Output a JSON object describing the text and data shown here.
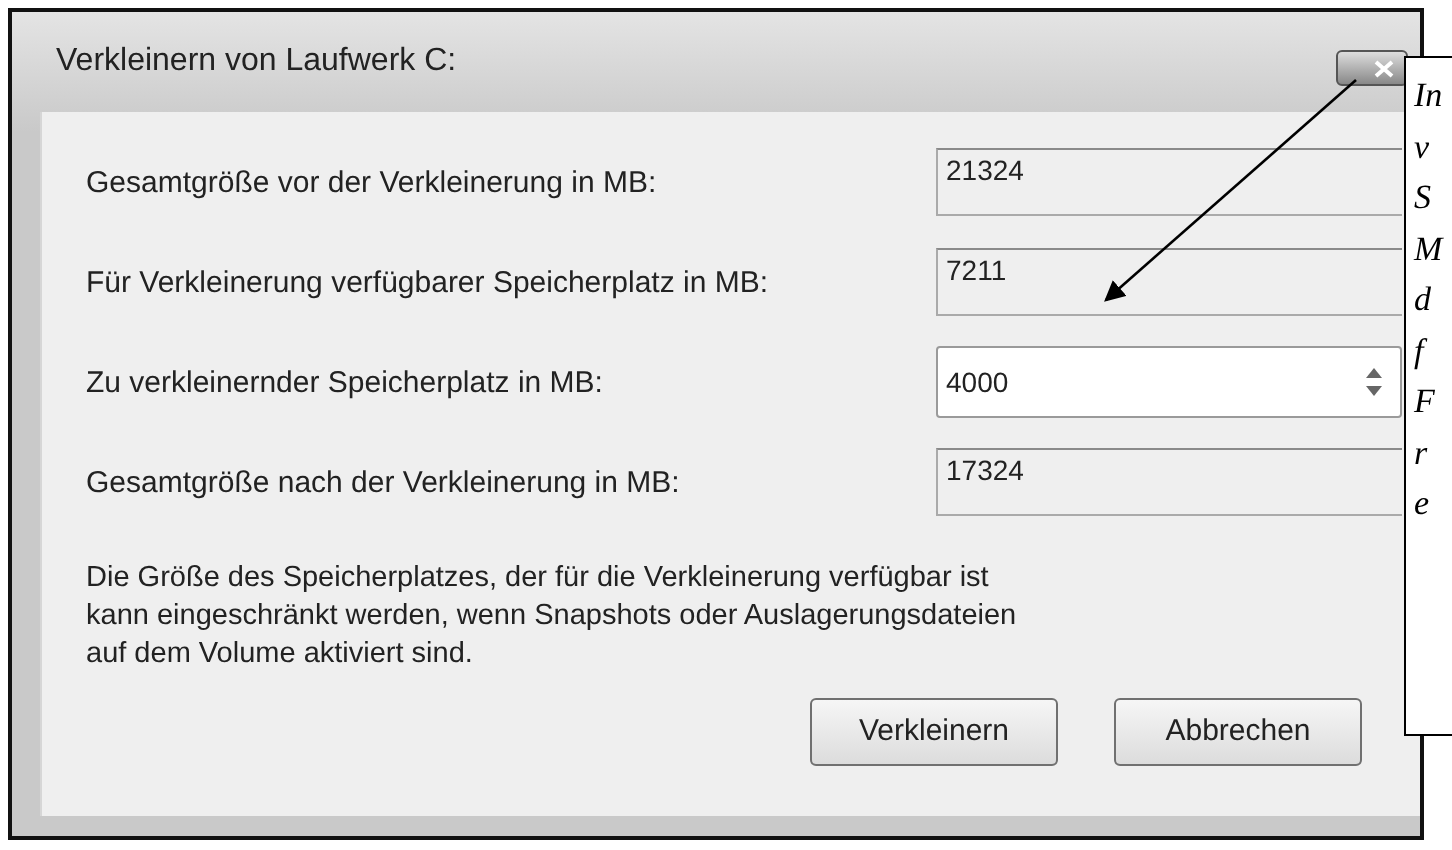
{
  "window": {
    "title": "Verkleinern von Laufwerk C:"
  },
  "fields": [
    {
      "kind": "readonly",
      "label": "Gesamtgröße vor der Verkleinerung in MB:",
      "value": "21324"
    },
    {
      "kind": "readonly",
      "label": "Für Verkleinerung verfügbarer Speicherplatz in MB:",
      "value": "7211"
    },
    {
      "kind": "spin",
      "label": "Zu verkleinernder Speicherplatz in MB:",
      "value": "4000"
    },
    {
      "kind": "readonly",
      "label": "Gesamtgröße nach der Verkleinerung in MB:",
      "value": "17324"
    }
  ],
  "note": "Die Größe des Speicherplatzes, der für die Verkleinerung verfügbar ist kann eingeschränkt werden, wenn Snapshots oder Auslagerungsdateien auf dem Volume aktiviert sind.",
  "buttons": [
    "Verkleinern",
    "Abbrechen"
  ],
  "callout": {
    "lines": [
      "In",
      "v",
      "S",
      "M",
      "d",
      "f",
      "F",
      "r",
      "e"
    ]
  }
}
